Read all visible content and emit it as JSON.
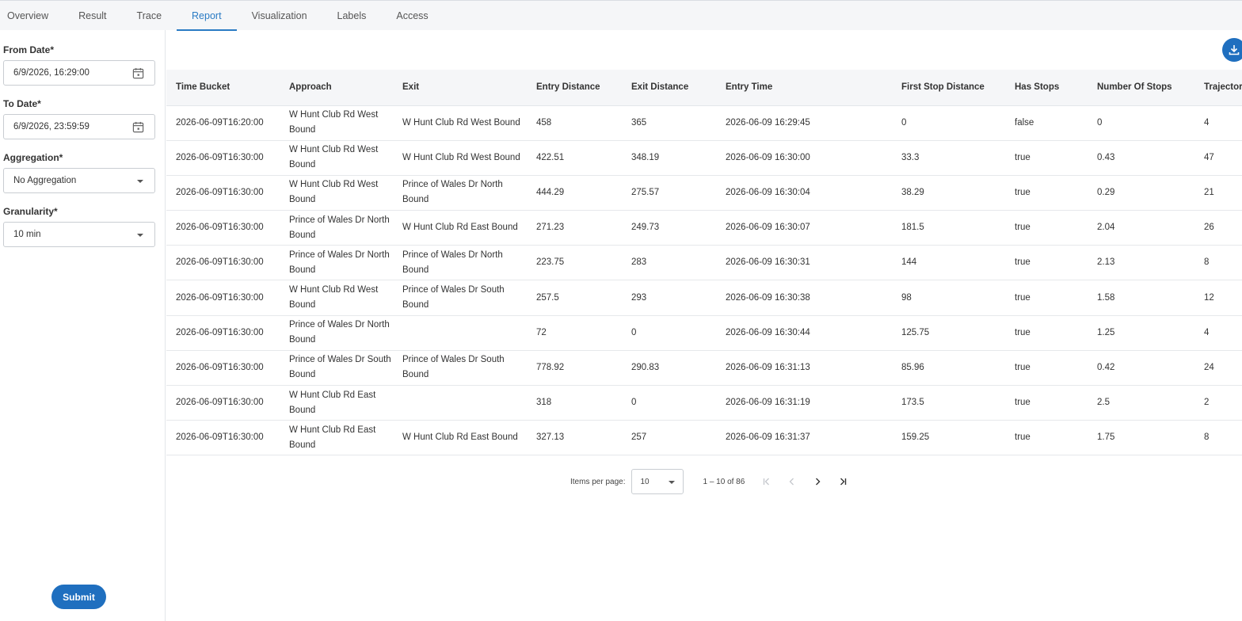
{
  "tabs": [
    "Overview",
    "Result",
    "Trace",
    "Report",
    "Visualization",
    "Labels",
    "Access"
  ],
  "active_tab": "Report",
  "sidebar": {
    "from_date": {
      "label": "From Date*",
      "value": "6/9/2026, 16:29:00"
    },
    "to_date": {
      "label": "To Date*",
      "value": "6/9/2026, 23:59:59"
    },
    "aggregation": {
      "label": "Aggregation*",
      "value": "No Aggregation"
    },
    "granularity": {
      "label": "Granularity*",
      "value": "10 min"
    },
    "submit_label": "Submit"
  },
  "table": {
    "columns": [
      "Time Bucket",
      "Approach",
      "Exit",
      "Entry Distance",
      "Exit Distance",
      "Entry Time",
      "First Stop Distance",
      "Has Stops",
      "Number Of Stops",
      "Trajector"
    ],
    "rows": [
      [
        "2026-06-09T16:20:00",
        "W Hunt Club Rd West Bound",
        "W Hunt Club Rd West Bound",
        "458",
        "365",
        "2026-06-09 16:29:45",
        "0",
        "false",
        "0",
        "4"
      ],
      [
        "2026-06-09T16:30:00",
        "W Hunt Club Rd West Bound",
        "W Hunt Club Rd West Bound",
        "422.51",
        "348.19",
        "2026-06-09 16:30:00",
        "33.3",
        "true",
        "0.43",
        "47"
      ],
      [
        "2026-06-09T16:30:00",
        "W Hunt Club Rd West Bound",
        "Prince of Wales Dr North Bound",
        "444.29",
        "275.57",
        "2026-06-09 16:30:04",
        "38.29",
        "true",
        "0.29",
        "21"
      ],
      [
        "2026-06-09T16:30:00",
        "Prince of Wales Dr North Bound",
        "W Hunt Club Rd East Bound",
        "271.23",
        "249.73",
        "2026-06-09 16:30:07",
        "181.5",
        "true",
        "2.04",
        "26"
      ],
      [
        "2026-06-09T16:30:00",
        "Prince of Wales Dr North Bound",
        "Prince of Wales Dr North Bound",
        "223.75",
        "283",
        "2026-06-09 16:30:31",
        "144",
        "true",
        "2.13",
        "8"
      ],
      [
        "2026-06-09T16:30:00",
        "W Hunt Club Rd West Bound",
        "Prince of Wales Dr South Bound",
        "257.5",
        "293",
        "2026-06-09 16:30:38",
        "98",
        "true",
        "1.58",
        "12"
      ],
      [
        "2026-06-09T16:30:00",
        "Prince of Wales Dr North Bound",
        "",
        "72",
        "0",
        "2026-06-09 16:30:44",
        "125.75",
        "true",
        "1.25",
        "4"
      ],
      [
        "2026-06-09T16:30:00",
        "Prince of Wales Dr South Bound",
        "Prince of Wales Dr South Bound",
        "778.92",
        "290.83",
        "2026-06-09 16:31:13",
        "85.96",
        "true",
        "0.42",
        "24"
      ],
      [
        "2026-06-09T16:30:00",
        "W Hunt Club Rd East Bound",
        "",
        "318",
        "0",
        "2026-06-09 16:31:19",
        "173.5",
        "true",
        "2.5",
        "2"
      ],
      [
        "2026-06-09T16:30:00",
        "W Hunt Club Rd East Bound",
        "W Hunt Club Rd East Bound",
        "327.13",
        "257",
        "2026-06-09 16:31:37",
        "159.25",
        "true",
        "1.75",
        "8"
      ]
    ]
  },
  "pagination": {
    "items_per_page_label": "Items per page:",
    "items_per_page": "10",
    "range": "1 – 10 of 86"
  },
  "icons": {
    "calendar": "calendar-icon",
    "download": "download-icon",
    "first": "first-page-icon",
    "prev": "prev-page-icon",
    "next": "next-page-icon",
    "last": "last-page-icon"
  },
  "colors": {
    "accent": "#1f6fbf",
    "tab_active": "#2a7bc4"
  }
}
